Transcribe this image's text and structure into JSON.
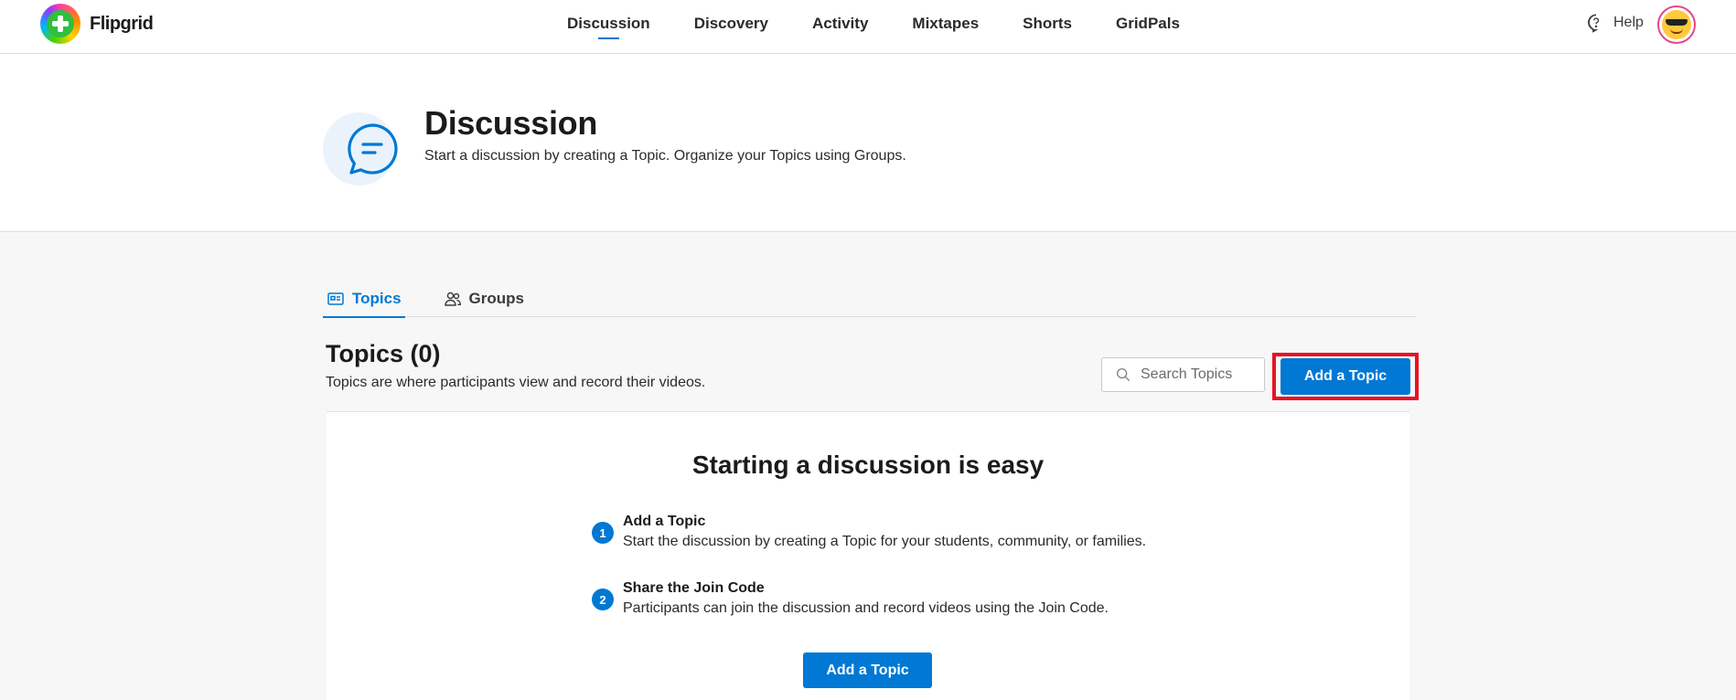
{
  "app": {
    "name": "Flipgrid"
  },
  "nav": {
    "items": [
      {
        "label": "Discussion",
        "active": true
      },
      {
        "label": "Discovery"
      },
      {
        "label": "Activity"
      },
      {
        "label": "Mixtapes"
      },
      {
        "label": "Shorts"
      },
      {
        "label": "GridPals"
      }
    ],
    "help_label": "Help"
  },
  "header": {
    "title": "Discussion",
    "subtitle": "Start a discussion by creating a Topic. Organize your Topics using Groups."
  },
  "tabs": [
    {
      "label": "Topics",
      "active": true,
      "icon": "topics-icon"
    },
    {
      "label": "Groups",
      "icon": "groups-icon"
    }
  ],
  "topics": {
    "title": "Topics (0)",
    "description": "Topics are where participants view and record their videos.",
    "search_placeholder": "Search Topics",
    "add_button_label": "Add a Topic"
  },
  "empty_state": {
    "title": "Starting a discussion is easy",
    "steps": [
      {
        "number": "1",
        "title": "Add a Topic",
        "description": "Start the discussion by creating a Topic for your students, community, or families."
      },
      {
        "number": "2",
        "title": "Share the Join Code",
        "description": "Participants can join the discussion and record videos using the Join Code."
      }
    ],
    "button_label": "Add a Topic"
  },
  "colors": {
    "accent": "#0078d4",
    "highlight": "#e81123"
  }
}
